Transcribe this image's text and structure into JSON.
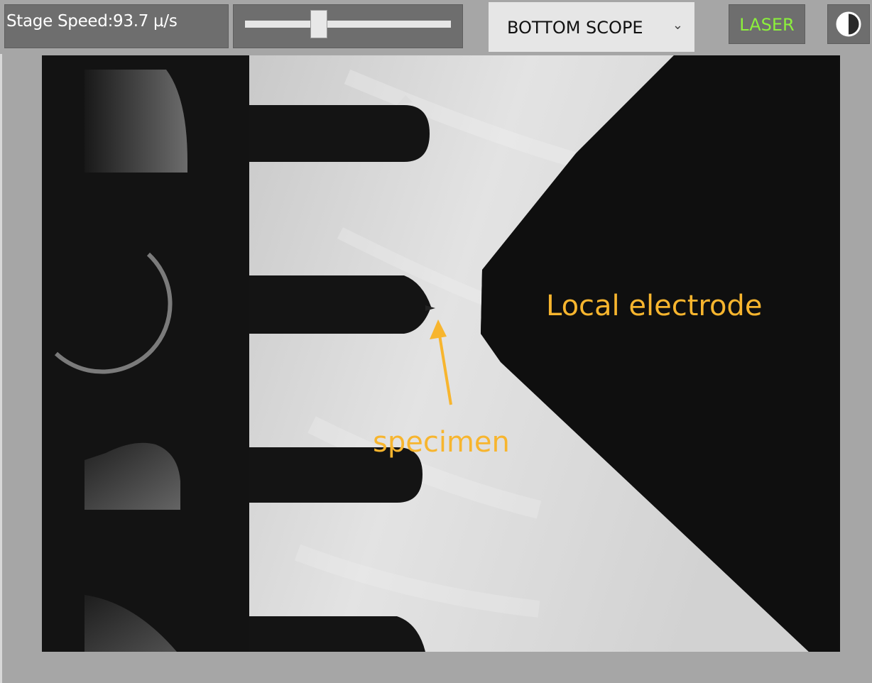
{
  "toolbar": {
    "stage_speed_label": "Stage Speed:93.7 µ/s",
    "speed_slider_value": 0.36,
    "scope": {
      "selected": "BOTTOM SCOPE"
    },
    "laser_label": "LASER",
    "laser_color": "#8cf03c",
    "contrast_icon": "contrast-icon"
  },
  "viewport": {
    "annotations": {
      "electrode_label": "Local electrode",
      "specimen_label": "specimen",
      "color": "#f7b52e"
    }
  }
}
